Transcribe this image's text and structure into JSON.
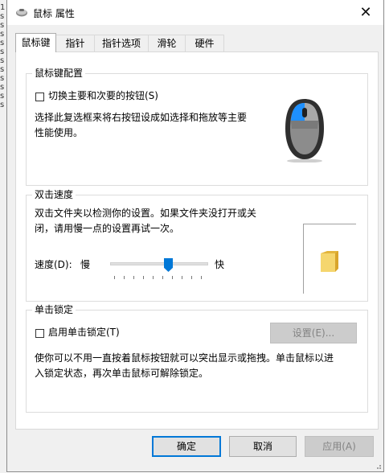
{
  "window": {
    "title": "鼠标 属性",
    "close_glyph": "✕"
  },
  "tabs": [
    {
      "label": "鼠标键",
      "active": true
    },
    {
      "label": "指针",
      "active": false
    },
    {
      "label": "指针选项",
      "active": false
    },
    {
      "label": "滑轮",
      "active": false
    },
    {
      "label": "硬件",
      "active": false
    }
  ],
  "button_config": {
    "title": "鼠标键配置",
    "switch_checkbox": {
      "label": "切换主要和次要的按钮(S)",
      "checked": false
    },
    "description_line1": "选择此复选框来将右按钮设成如选择和拖放等主要",
    "description_line2": "性能使用。"
  },
  "double_click": {
    "title": "双击速度",
    "description_line1": "双击文件夹以检测你的设置。如果文件夹没打开或关",
    "description_line2": "闭，请用慢一点的设置再试一次。",
    "speed_label": "速度(D):",
    "slow_label": "慢",
    "fast_label": "快",
    "speed_fraction": 0.6
  },
  "click_lock": {
    "title": "单击锁定",
    "checkbox": {
      "label": "启用单击锁定(T)",
      "checked": false
    },
    "settings_button": "设置(E)...",
    "description_line1": "使你可以不用一直按着鼠标按钮就可以突出显示或拖拽。单击鼠标以进",
    "description_line2": "入锁定状态，再次单击鼠标可解除锁定。"
  },
  "footer": {
    "ok": "确定",
    "cancel": "取消",
    "apply": "应用(A)"
  },
  "colors": {
    "accent": "#0078d7",
    "mouse_body": "#404040",
    "mouse_button": "#1e90ff",
    "folder": "#f5d66e"
  },
  "background_lines": [
    "1",
    "s",
    "s",
    "s",
    "s",
    "s",
    "s",
    "s",
    "s",
    "s",
    "s",
    "s"
  ]
}
